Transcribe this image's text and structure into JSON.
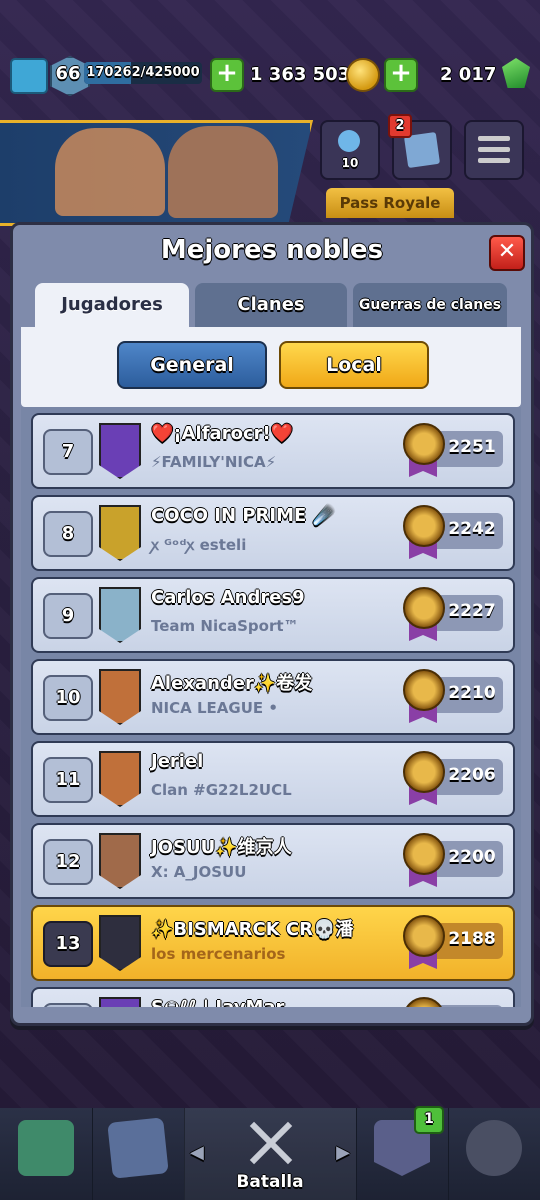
{
  "topbar": {
    "level": "66",
    "xp_text": "170262/425000",
    "xp_fraction": 0.4,
    "gold": "1 363 503",
    "gems": "2 017"
  },
  "hud": {
    "friends_count": "10",
    "news_badge": "2",
    "pass_royale_label": "Pass Royale"
  },
  "modal": {
    "title": "Mejores nobles",
    "tabs": [
      {
        "label": "Jugadores",
        "active": true
      },
      {
        "label": "Clanes",
        "active": false
      },
      {
        "label": "Guerras de clanes",
        "active": false
      }
    ],
    "scope_buttons": [
      {
        "label": "General"
      },
      {
        "label": "Local"
      }
    ]
  },
  "leaderboard": [
    {
      "rank": "7",
      "name": "❤️¡Alfarocr!❤️",
      "clan": "⚡FAMILY'NICA⚡",
      "trophies": "2251",
      "badge_color": "#6a3fb5",
      "highlight": false
    },
    {
      "rank": "8",
      "name": "COCO IN PRIME ☄️",
      "clan": "ꭗ ᴳᵒᵈꭗ esteli",
      "trophies": "2242",
      "badge_color": "#c9a22b",
      "highlight": false
    },
    {
      "rank": "9",
      "name": "Carlos Andres9",
      "clan": "Team NicaSport™",
      "trophies": "2227",
      "badge_color": "#8ab2c9",
      "highlight": false
    },
    {
      "rank": "10",
      "name": "Alexander✨卷发",
      "clan": "NICA LEAGUE •",
      "trophies": "2210",
      "badge_color": "#c0703a",
      "highlight": false
    },
    {
      "rank": "11",
      "name": "Jeriel",
      "clan": "Clan #G22L2UCL",
      "trophies": "2206",
      "badge_color": "#c0703a",
      "highlight": false
    },
    {
      "rank": "12",
      "name": "JOSUU✨维京人",
      "clan": "X: A_JOSUU",
      "trophies": "2200",
      "badge_color": "#a06a4a",
      "highlight": false
    },
    {
      "rank": "13",
      "name": "✨BISMARCK CR💀潘",
      "clan": "los mercenarios",
      "trophies": "2188",
      "badge_color": "#2e2e3e",
      "highlight": true
    },
    {
      "rank": "",
      "name": "S℮ℓℓ | JayMar",
      "clan": "",
      "trophies": "",
      "badge_color": "#6a3fb5",
      "highlight": false
    }
  ],
  "bottom_nav": {
    "active_label": "Batalla",
    "cards_badge": "1"
  }
}
